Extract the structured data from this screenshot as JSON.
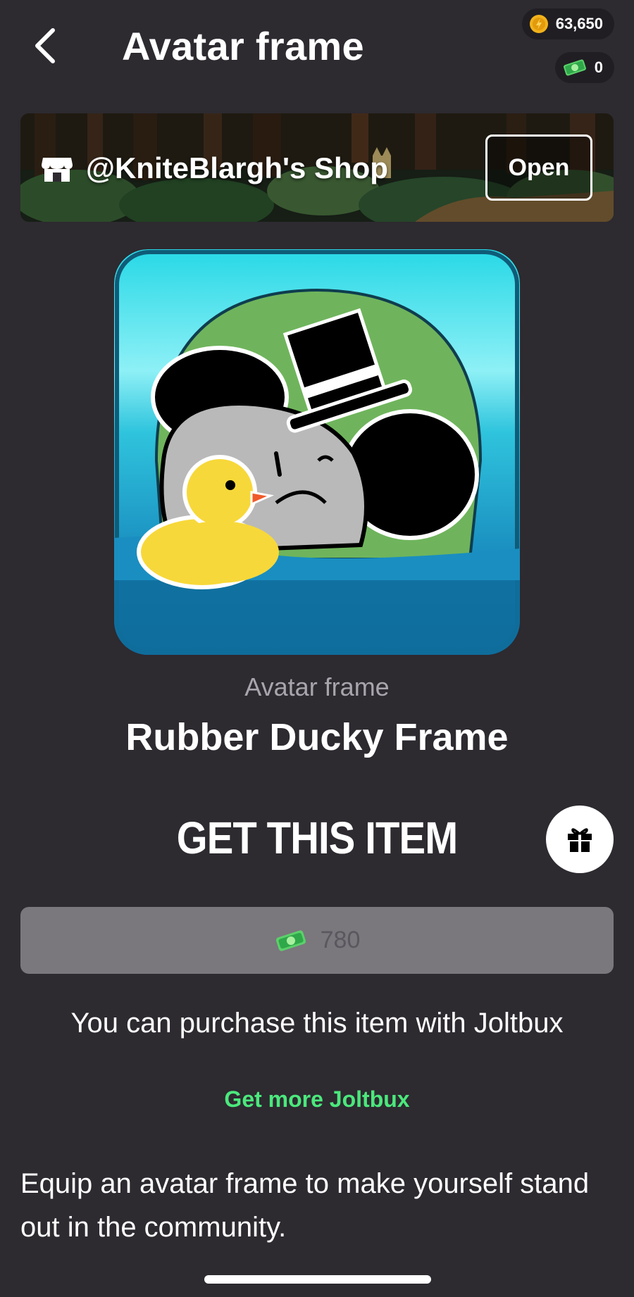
{
  "header": {
    "title": "Avatar frame",
    "coins": "63,650",
    "joltbux": "0"
  },
  "shop": {
    "name": "@KniteBlargh's Shop",
    "open_label": "Open"
  },
  "item": {
    "category": "Avatar frame",
    "name": "Rubber Ducky Frame"
  },
  "purchase": {
    "title": "GET THIS ITEM",
    "price": "780",
    "note": "You can purchase this item with Joltbux",
    "get_more_label": "Get more Joltbux"
  },
  "description": "Equip an avatar frame to make yourself stand out in the community.",
  "colors": {
    "background": "#2d2a30",
    "accent_green": "#4be87c",
    "coin_gold": "#f2b21b",
    "price_button": "#7a777d"
  },
  "icons": {
    "back": "chevron-left-icon",
    "coin": "coin-icon",
    "joltbux": "joltbux-icon",
    "shop": "shop-icon",
    "gift": "gift-icon"
  }
}
